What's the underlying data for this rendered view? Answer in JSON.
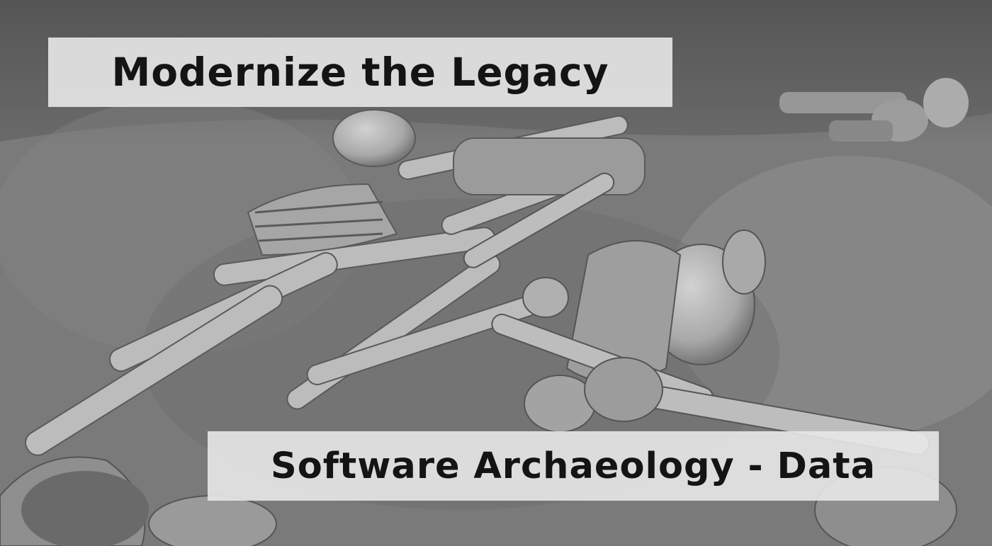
{
  "slide": {
    "title": "Modernize the Legacy",
    "subtitle": "Software Archaeology - Data"
  },
  "image": {
    "subject": "excavated-skeletons-photo",
    "tone": "grayscale"
  },
  "colors": {
    "banner_background": "#e8e8e8",
    "banner_text": "#141414",
    "soil": "#777777",
    "bone": "#bdbdbd"
  }
}
